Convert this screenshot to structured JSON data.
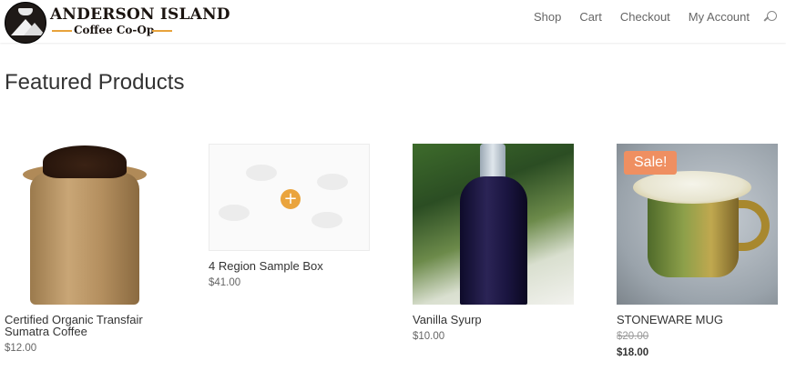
{
  "brand": {
    "title": "ANDERSON ISLAND",
    "subtitle": "Coffee Co-Op"
  },
  "nav": {
    "items": [
      "Shop",
      "Cart",
      "Checkout",
      "My Account"
    ],
    "search_icon": "search-icon"
  },
  "section": {
    "title": "Featured Products"
  },
  "products": [
    {
      "name": "Certified Organic Transfair Sumatra Coffee",
      "price": "$12.00"
    },
    {
      "name": "4 Region Sample Box",
      "price": "$41.00"
    },
    {
      "name": "Vanilla Syurp",
      "price": "$10.00"
    },
    {
      "name": "STONEWARE MUG",
      "old_price": "$20.00",
      "price": "$18.00",
      "badge": "Sale!"
    }
  ],
  "colors": {
    "accent": "#eaa43d",
    "sale_badge": "#ef8f61"
  }
}
